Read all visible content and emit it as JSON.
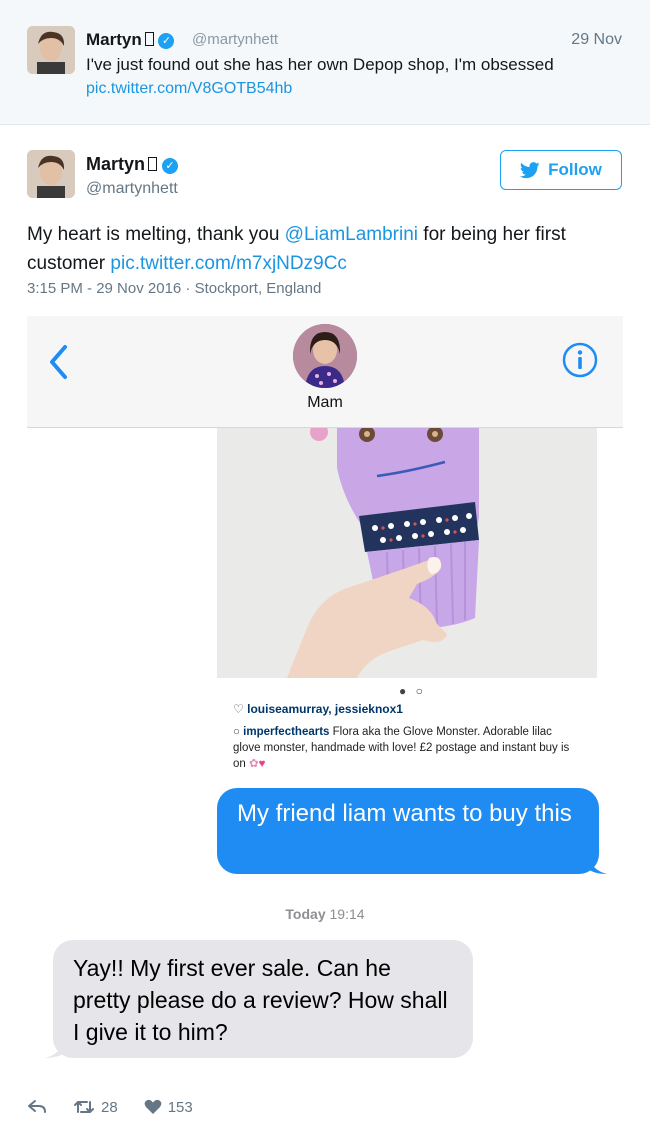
{
  "parent_tweet": {
    "name": "Martyn",
    "handle": "@martynhett",
    "date": "29 Nov",
    "text": "I've just found out she has her own Depop shop, I'm obsessed",
    "link": "pic.twitter.com/V8GOTB54hb"
  },
  "tweet": {
    "name": "Martyn",
    "handle": "@martynhett",
    "follow_label": "Follow",
    "text_before": "My heart is melting, thank you ",
    "mention": "@LiamLambrini",
    "text_after": " for being her first customer ",
    "link": "pic.twitter.com/m7xjNDz9Cc",
    "meta": "3:15 PM - 29 Nov 2016 · Stockport, England",
    "retweets": "28",
    "likes": "153"
  },
  "imessage": {
    "contact_name": "Mam",
    "ig_likes": "louiseamurray, jessieknox1",
    "ig_user": "imperfecthearts",
    "ig_caption": " Flora aka the Glove Monster. Adorable lilac glove monster, handmade with love! £2 postage and instant buy is on",
    "sent_message": "My friend liam wants to buy this",
    "timestamp_day": "Today",
    "timestamp_time": "19:14",
    "received_message": "Yay!! My first ever sale. Can he pretty please do a review? How shall I give it to him?"
  },
  "colors": {
    "twitter_blue": "#1da1f2",
    "link_blue": "#1b95e0",
    "imessage_blue": "#1e8cf3",
    "bubble_gray": "#e5e5ea"
  }
}
